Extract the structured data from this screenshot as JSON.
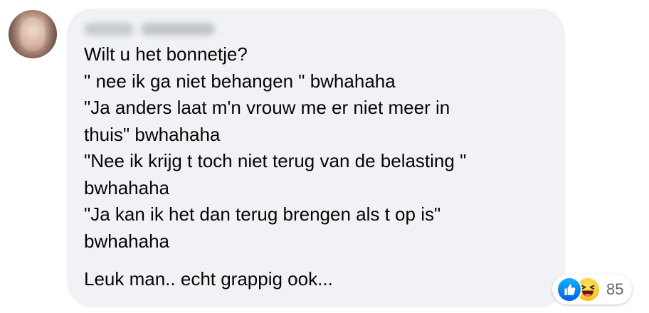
{
  "comment": {
    "author_name": "Susan Webster",
    "lines": [
      "Wilt u het bonnetje?",
      "\" nee ik ga niet behangen \" bwhahaha",
      "\"Ja anders laat m'n vrouw me er niet meer in",
      "thuis\" bwhahaha",
      "\"Nee ik krijg t toch niet terug van de belasting \"",
      "bwhahaha",
      "\"Ja kan ik het dan terug brengen als t op is\"",
      "bwhahaha"
    ],
    "closing_line": "Leuk man.. echt grappig ook..."
  },
  "reactions": {
    "icons": [
      "like-icon",
      "haha-icon"
    ],
    "count": "85"
  },
  "colors": {
    "bubble_background": "#f0f2f5",
    "text": "#050505",
    "count_text": "#65676b",
    "like_blue": "#0866ff",
    "haha_yellow": "#fdcd33"
  }
}
